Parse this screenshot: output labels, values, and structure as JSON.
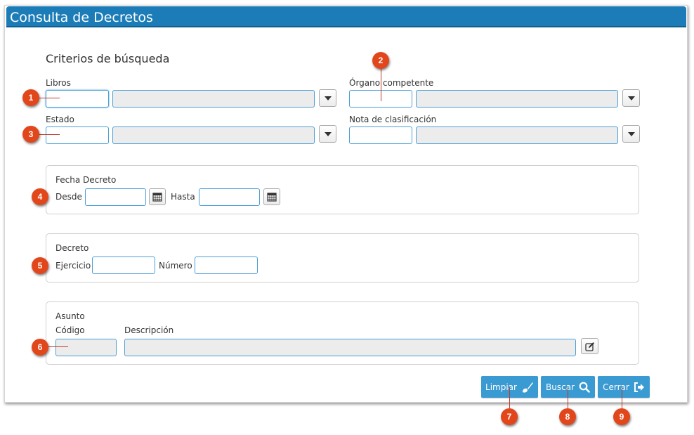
{
  "dialog": {
    "title": "Consulta de Decretos"
  },
  "criteria": {
    "heading": "Criterios de búsqueda",
    "libros_label": "Libros",
    "organo_label": "Órgano competente",
    "estado_label": "Estado",
    "nota_label": "Nota de clasificación"
  },
  "fecha": {
    "legend": "Fecha Decreto",
    "desde_label": "Desde",
    "hasta_label": "Hasta"
  },
  "decreto": {
    "legend": "Decreto",
    "ejercicio_label": "Ejercicio",
    "numero_label": "Número"
  },
  "asunto": {
    "legend": "Asunto",
    "codigo_label": "Código",
    "descripcion_label": "Descripción"
  },
  "actions": {
    "limpiar_label": "Limpiar",
    "buscar_label": "Buscar",
    "cerrar_label": "Cerrar"
  },
  "markers": [
    "1",
    "2",
    "3",
    "4",
    "5",
    "6",
    "7",
    "8",
    "9"
  ],
  "colors": {
    "header": "#1b7cb8",
    "button": "#3a9ad2",
    "marker": "#e2471c",
    "input_border": "#4a9fd6"
  },
  "icons": {
    "dropdown": "caret-down-icon",
    "calendar": "calendar-icon",
    "edit": "edit-icon",
    "limpiar": "brush-icon",
    "buscar": "search-icon",
    "cerrar": "exit-icon"
  }
}
